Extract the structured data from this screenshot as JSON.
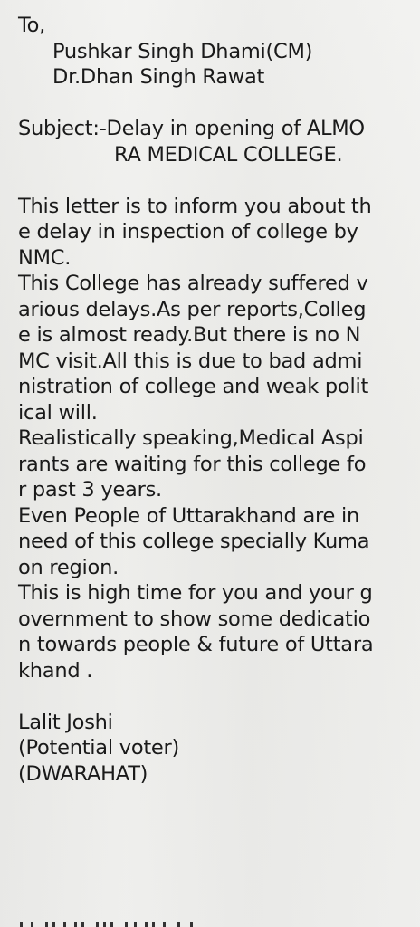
{
  "letter": {
    "salutation": "To,",
    "recipients": [
      "Pushkar Singh Dhami(CM)",
      "Dr.Dhan Singh Rawat"
    ],
    "subject_lines": [
      "Subject:-Delay in opening of ALMO",
      "RA MEDICAL COLLEGE."
    ],
    "body_lines": [
      "This letter is to inform you about th",
      "e delay in inspection of college by",
      "NMC.",
      "This College has already suffered v",
      "arious delays.As per reports,Colleg",
      "e is almost ready.But there is no N",
      "MC visit.All this is due to bad admi",
      "nistration of college and weak polit",
      "ical will.",
      "Realistically speaking,Medical Aspi",
      "rants are waiting for this college fo",
      "r past 3 years.",
      "Even People of Uttarakhand are in",
      "need of this college specially Kuma",
      "on region.",
      "This is high time for you and your g",
      "overnment to show some dedicatio",
      "n towards people & future of Uttara",
      "khand ."
    ],
    "signature_lines": [
      "Lalit Joshi",
      "(Potential voter)",
      "(DWARAHAT)"
    ]
  }
}
